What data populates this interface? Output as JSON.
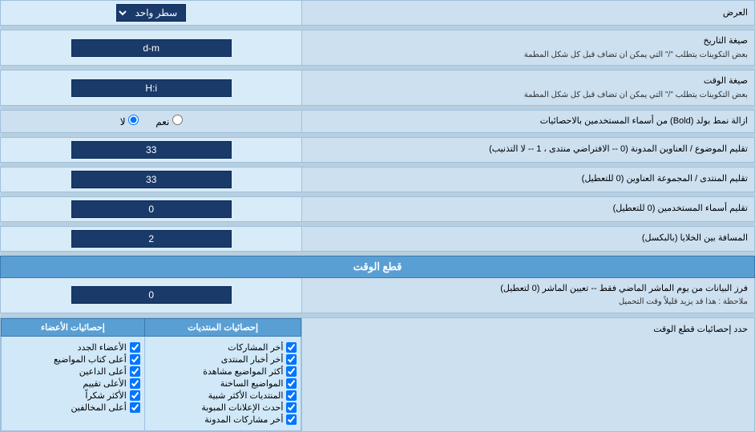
{
  "header": {
    "ard_label": "العرض",
    "satr_wahed_label": "سطر واحد"
  },
  "date_format": {
    "label": "صيغة التاريخ",
    "sublabel": "بعض التكوينات يتطلب \"/\" التي يمكن ان تضاف قبل كل شكل المطمة",
    "value": "d-m"
  },
  "time_format": {
    "label": "صيغة الوقت",
    "sublabel": "بعض التكوينات يتطلب \"/\" التي يمكن ان تضاف قبل كل شكل المطمة",
    "value": "H:i"
  },
  "bold_remove": {
    "label": "ازالة نمط بولد (Bold) من أسماء المستخدمين بالاحصائيات",
    "option_yes": "نعم",
    "option_no": "لا",
    "selected": "no"
  },
  "topics_order": {
    "label": "تقليم الموضوع / العناوين المدونة (0 -- الافتراضي منتدى ، 1 -- لا التذنيب)",
    "value": "33"
  },
  "forum_order": {
    "label": "تقليم المنتدى / المجموعة العناوين (0 للتعطيل)",
    "value": "33"
  },
  "users_order": {
    "label": "تقليم أسماء المستخدمين (0 للتعطيل)",
    "value": "0"
  },
  "cell_spacing": {
    "label": "المسافة بين الخلايا (بالبكسل)",
    "value": "2"
  },
  "time_cut": {
    "section_title": "قطع الوقت",
    "label": "فرز البيانات من يوم الماشر الماضي فقط -- تعيين الماشر (0 لتعطيل)",
    "sublabel": "ملاحظة : هذا قد يزيد قليلاً وقت التحميل",
    "value": "0"
  },
  "stats_limit": {
    "label": "حدد إحصائيات قطع الوقت"
  },
  "col_memberstats": {
    "label": "إحصائيات المنتديات"
  },
  "col_memberstats2": {
    "label": "إحصائيات الأعضاء"
  },
  "checkboxes_forum": [
    {
      "id": "cb_f1",
      "label": "أخر المشاركات"
    },
    {
      "id": "cb_f2",
      "label": "أخر أخبار المنتدى"
    },
    {
      "id": "cb_f3",
      "label": "أكثر المواضيع مشاهدة"
    },
    {
      "id": "cb_f4",
      "label": "المواضيع الساخنة"
    },
    {
      "id": "cb_f5",
      "label": "المنتديات الأكثر شبية"
    },
    {
      "id": "cb_f6",
      "label": "أحدث الإعلانات المبوبة"
    },
    {
      "id": "cb_f7",
      "label": "أخر مشاركات المدونة"
    }
  ],
  "checkboxes_members": [
    {
      "id": "cb_m1",
      "label": "الأعضاء الجدد"
    },
    {
      "id": "cb_m2",
      "label": "أعلى كتاب المواضيع"
    },
    {
      "id": "cb_m3",
      "label": "أعلى الداعين"
    },
    {
      "id": "cb_m4",
      "label": "الأعلى تقييم"
    },
    {
      "id": "cb_m5",
      "label": "الأكثر شكراً"
    },
    {
      "id": "cb_m6",
      "label": "أعلى المخالفين"
    }
  ],
  "checkboxes_members_col1": [
    {
      "id": "cb_m1",
      "label": "الأعضاء الجدد"
    },
    {
      "id": "cb_m2",
      "label": "أعلى كتاب المواضيع"
    },
    {
      "id": "cb_m3",
      "label": "أعلى الداعين"
    },
    {
      "id": "cb_m4",
      "label": "الأعلى تقييم"
    },
    {
      "id": "cb_m5",
      "label": "الأكثر شكراً"
    },
    {
      "id": "cb_m6",
      "label": "أعلى المخالفين"
    }
  ]
}
